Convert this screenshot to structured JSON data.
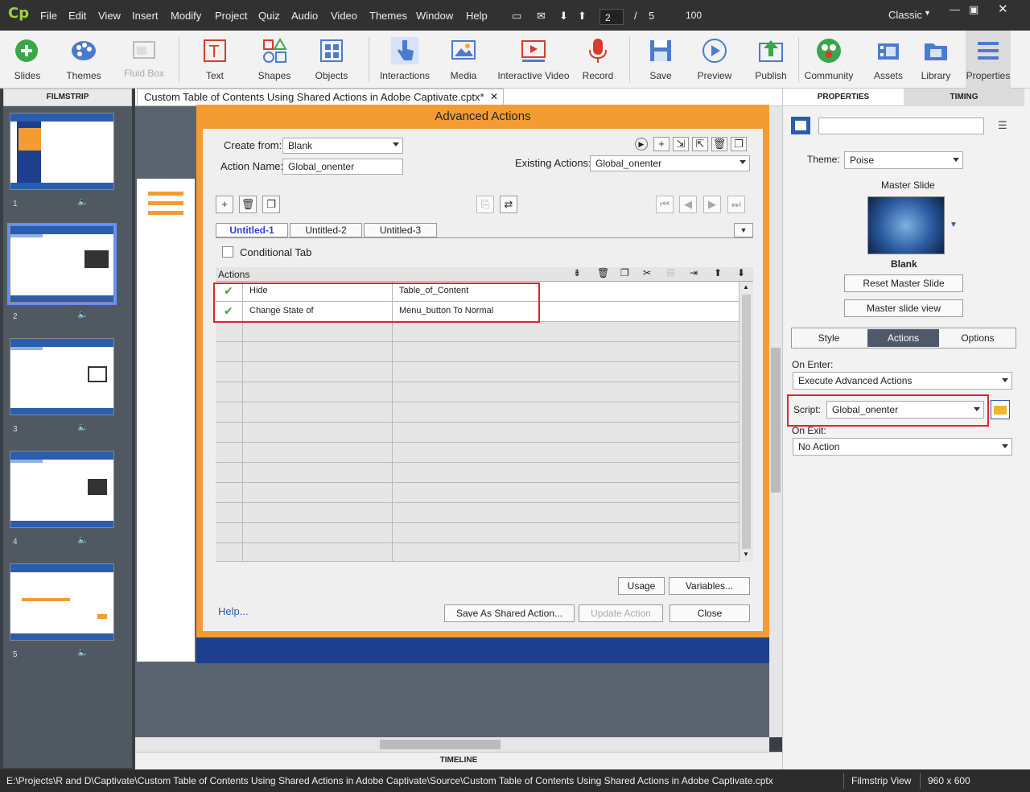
{
  "menu": [
    "File",
    "Edit",
    "View",
    "Insert",
    "Modify",
    "Project",
    "Quiz",
    "Audio",
    "Video",
    "Themes",
    "Window",
    "Help"
  ],
  "menubar": {
    "page_current": "2",
    "page_sep": "/",
    "page_total": "5",
    "zoom": "100",
    "workspace": "Classic",
    "logo": "Cp"
  },
  "toolbar": {
    "slides": "Slides",
    "themes": "Themes",
    "fluid_box": "Fluid Box",
    "text": "Text",
    "shapes": "Shapes",
    "objects": "Objects",
    "interactions": "Interactions",
    "media": "Media",
    "interactive_video": "Interactive Video",
    "record": "Record",
    "save": "Save",
    "preview": "Preview",
    "publish": "Publish",
    "community": "Community",
    "assets": "Assets",
    "library": "Library",
    "properties": "Properties"
  },
  "filmstrip": {
    "header": "FILMSTRIP",
    "slides": [
      {
        "num": "1"
      },
      {
        "num": "2"
      },
      {
        "num": "3"
      },
      {
        "num": "4"
      },
      {
        "num": "5"
      }
    ]
  },
  "document_tab": "Custom Table of Contents Using Shared Actions in Adobe Captivate.cptx*",
  "timeline_label": "TIMELINE",
  "dialog": {
    "title": "Advanced Actions",
    "create_from_label": "Create from:",
    "create_from_value": "Blank",
    "action_name_label": "Action Name:",
    "action_name_value": "Global_onenter",
    "existing_actions_label": "Existing Actions:",
    "existing_actions_value": "Global_onenter",
    "tabs": [
      "Untitled-1",
      "Untitled-2",
      "Untitled-3"
    ],
    "conditional_tab": "Conditional Tab",
    "actions_header": "Actions",
    "rows": [
      {
        "action": "Hide",
        "target": "Table_of_Content"
      },
      {
        "action": "Change State of",
        "target": "Menu_button  To   Normal"
      }
    ],
    "usage": "Usage",
    "variables": "Variables...",
    "help": "Help...",
    "save_shared": "Save As Shared Action...",
    "update_action": "Update Action",
    "close": "Close"
  },
  "properties": {
    "tab_properties": "PROPERTIES",
    "tab_timing": "TIMING",
    "theme_label": "Theme:",
    "theme_value": "Poise",
    "master_slide_label": "Master Slide",
    "master_name": "Blank",
    "reset_master": "Reset Master Slide",
    "master_view": "Master slide view",
    "seg_style": "Style",
    "seg_actions": "Actions",
    "seg_options": "Options",
    "on_enter_label": "On Enter:",
    "on_enter_value": "Execute Advanced Actions",
    "script_label": "Script:",
    "script_value": "Global_onenter",
    "on_exit_label": "On Exit:",
    "on_exit_value": "No Action"
  },
  "status": {
    "path": "E:\\Projects\\R and D\\Captivate\\Custom Table of Contents Using Shared Actions in Adobe Captivate\\Source\\Custom Table of Contents Using Shared Actions in Adobe Captivate.cptx",
    "view": "Filmstrip View",
    "size": "960 x 600"
  }
}
